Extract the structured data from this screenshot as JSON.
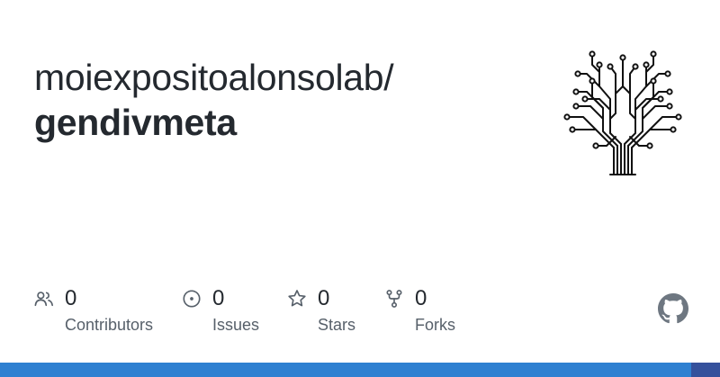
{
  "repo": {
    "owner": "moiexpositoalonsolab/",
    "name": "gendivmeta"
  },
  "stats": [
    {
      "icon": "people-icon",
      "count": "0",
      "label": "Contributors"
    },
    {
      "icon": "issue-icon",
      "count": "0",
      "label": "Issues"
    },
    {
      "icon": "star-icon",
      "count": "0",
      "label": "Stars"
    },
    {
      "icon": "fork-icon",
      "count": "0",
      "label": "Forks"
    }
  ],
  "colors": {
    "text": "#24292f",
    "muted": "#57606a",
    "bar_primary": "#2f80d1",
    "bar_secondary": "#35519c"
  }
}
